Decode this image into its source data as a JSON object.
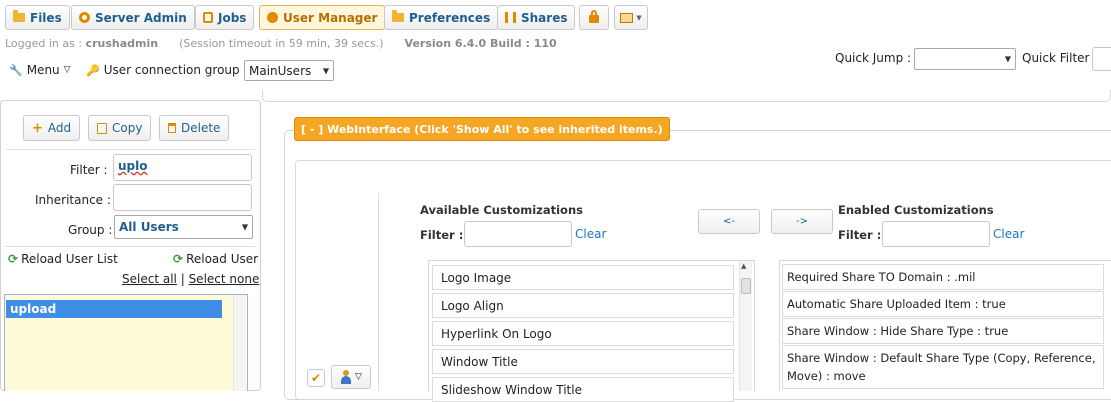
{
  "tabs": [
    {
      "label": "Files",
      "icon": "folder-icon"
    },
    {
      "label": "Server Admin",
      "icon": "gear-icon"
    },
    {
      "label": "Jobs",
      "icon": "jobs-icon"
    },
    {
      "label": "User Manager",
      "icon": "user-icon"
    },
    {
      "label": "Preferences",
      "icon": "preferences-icon"
    },
    {
      "label": "Shares",
      "icon": "shares-icon"
    }
  ],
  "session": {
    "logged_in_label": "Logged in as :",
    "username": "crushadmin",
    "timeout": "(Session timeout in 59 min, 39 secs.)",
    "version": "Version 6.4.0 Build : 110"
  },
  "toolbar": {
    "menu_label": "Menu",
    "group_label": "User connection group :",
    "group_value": "MainUsers",
    "quick_jump_label": "Quick Jump :",
    "quick_jump_value": "",
    "quick_filter_label": "Quick Filter"
  },
  "left": {
    "add_label": "Add",
    "copy_label": "Copy",
    "delete_label": "Delete",
    "filter_label": "Filter :",
    "filter_value": "uplo",
    "inheritance_label": "Inheritance :",
    "inheritance_value": "",
    "group_label": "Group :",
    "group_value": "All Users",
    "reload_list_label": "Reload User List",
    "reload_user_label": "Reload User",
    "select_all": "Select all",
    "separator": "|",
    "select_none": "Select none",
    "users": [
      "upload"
    ]
  },
  "main": {
    "section_header": "[ - ] WebInterface (Click 'Show All' to see inherited items.)",
    "available_title": "Available Customizations",
    "enabled_title": "Enabled Customizations",
    "filter_label": "Filter :",
    "clear_label": "Clear",
    "move_left_label": "<-",
    "move_right_label": "->",
    "available_items": [
      "Logo Image",
      "Logo Align",
      "Hyperlink On Logo",
      "Window Title",
      "Slideshow Window Title"
    ],
    "enabled_items": [
      "Required Share TO Domain : .mil",
      "Automatic Share Uploaded Item : true",
      "Share Window : Hide Share Type : true",
      "Share Window : Default Share Type (Copy, Reference, Move) : move"
    ]
  },
  "colors": {
    "accent": "#f5a623",
    "link": "#1f76c0",
    "selection": "#3f8ee6"
  }
}
